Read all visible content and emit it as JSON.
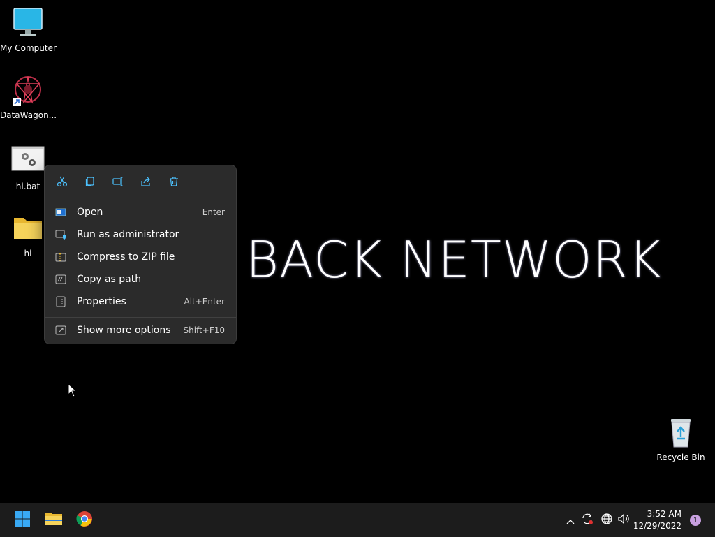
{
  "desktop": {
    "icons": [
      {
        "label": "My Computer",
        "icon": "computer-icon"
      },
      {
        "label": "DataWagon...",
        "icon": "datawagon-icon"
      },
      {
        "label": "hi.bat",
        "icon": "batch-file-icon"
      },
      {
        "label": "hi",
        "icon": "folder-icon"
      },
      {
        "label": "Recycle Bin",
        "icon": "recycle-bin-icon"
      }
    ],
    "wallpaper_text": "BACK NETWORK"
  },
  "context_menu": {
    "toolbar": [
      {
        "name": "cut",
        "icon": "scissors-icon"
      },
      {
        "name": "copy",
        "icon": "copy-icon"
      },
      {
        "name": "rename",
        "icon": "rename-icon"
      },
      {
        "name": "share",
        "icon": "share-icon"
      },
      {
        "name": "delete",
        "icon": "trash-icon"
      }
    ],
    "items": [
      {
        "label": "Open",
        "shortcut": "Enter",
        "icon": "open-icon"
      },
      {
        "label": "Run as administrator",
        "shortcut": "",
        "icon": "shield-icon"
      },
      {
        "label": "Compress to ZIP file",
        "shortcut": "",
        "icon": "zip-icon"
      },
      {
        "label": "Copy as path",
        "shortcut": "",
        "icon": "path-icon"
      },
      {
        "label": "Properties",
        "shortcut": "Alt+Enter",
        "icon": "properties-icon"
      },
      {
        "label": "Show more options",
        "shortcut": "Shift+F10",
        "icon": "more-options-icon"
      }
    ]
  },
  "taskbar": {
    "apps": [
      {
        "name": "start",
        "icon": "windows-start-icon"
      },
      {
        "name": "file-explorer",
        "icon": "folder-icon"
      },
      {
        "name": "chrome",
        "icon": "chrome-icon"
      }
    ],
    "tray": {
      "time": "3:52 AM",
      "date": "12/29/2022",
      "notification_count": "1"
    }
  },
  "colors": {
    "accent": "#4cc2ff",
    "menu_bg": "#2b2b2b",
    "taskbar_bg": "#1c1c1c"
  }
}
